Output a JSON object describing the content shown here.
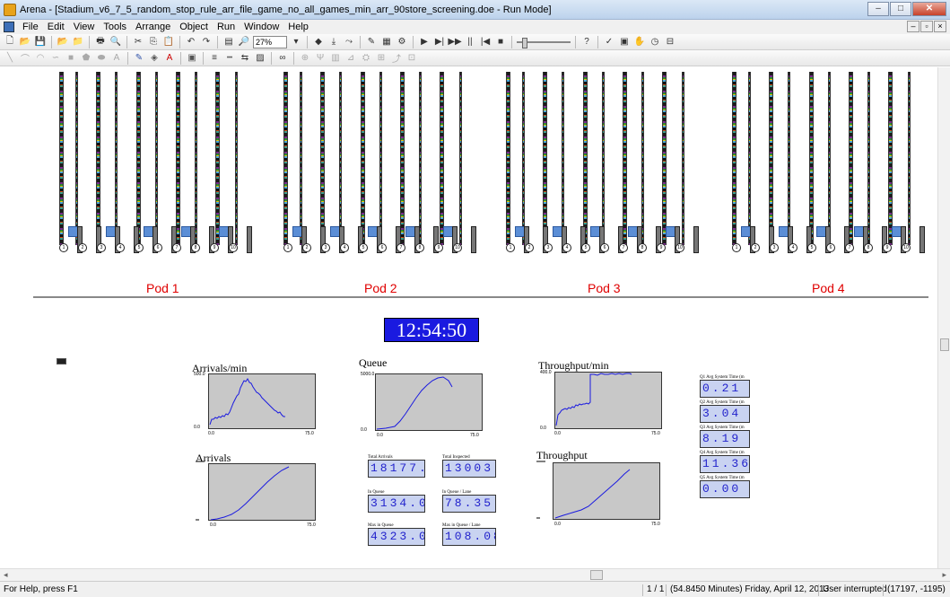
{
  "window": {
    "title": "Arena - [Stadium_v6_7_5_random_stop_rule_arr_file_game_no_all_games_min_arr_90store_screening.doe - Run Mode]",
    "minimize": "–",
    "maximize": "□",
    "close": "✕"
  },
  "menu": {
    "items": [
      "File",
      "Edit",
      "View",
      "Tools",
      "Arrange",
      "Object",
      "Run",
      "Window",
      "Help"
    ]
  },
  "toolbar": {
    "zoom": "27%"
  },
  "pods": [
    {
      "label": "Pod 1",
      "servers": [
        "1",
        "2",
        "3",
        "4",
        "5",
        "6",
        "7",
        "8",
        "9",
        "10"
      ]
    },
    {
      "label": "Pod 2",
      "servers": [
        "1",
        "2",
        "3",
        "4",
        "5",
        "6",
        "7",
        "8",
        "9",
        "10"
      ]
    },
    {
      "label": "Pod 3",
      "servers": [
        "1",
        "2",
        "3",
        "4",
        "5",
        "6",
        "7",
        "8",
        "9",
        "10"
      ]
    },
    {
      "label": "Pod 4",
      "servers": [
        "1",
        "2",
        "3",
        "4",
        "5",
        "6",
        "7",
        "8",
        "9",
        "10"
      ]
    }
  ],
  "clock": "12:54:50",
  "plots": {
    "arrivals_min": {
      "title": "Arrivals/min",
      "ymax": "500.0",
      "ymin": "0.0",
      "xmin": "0.0",
      "xmax": "75.0"
    },
    "queue": {
      "title": "Queue",
      "ymax": "5000.0",
      "ymin": "0.0",
      "xmin": "0.0",
      "xmax": "75.0"
    },
    "throughput_min": {
      "title": "Throughput/min",
      "ymax": "400.0",
      "ymin": "0.0",
      "xmin": "0.0",
      "xmax": "75.0"
    },
    "arrivals": {
      "title": "Arrivals",
      "xmin": "0.0",
      "xmax": "75.0"
    },
    "throughput": {
      "title": "Throughput",
      "xmin": "0.0",
      "xmax": "75.0"
    }
  },
  "monitors": {
    "total_arrivals": {
      "label": "Total Arrivals",
      "value": "18177.00"
    },
    "total_inspected": {
      "label": "Total Inspected",
      "value": "13003.00"
    },
    "in_queue": {
      "label": "In Queue",
      "value": "3134.00"
    },
    "in_queue_lane": {
      "label": "In Queue / Lane",
      "value": "78.35"
    },
    "max_in_queue": {
      "label": "Max in Queue",
      "value": "4323.00"
    },
    "max_in_queue_lane": {
      "label": "Max in Queue / Lane",
      "value": "108.08"
    }
  },
  "quantiles": [
    {
      "label": "Q1 Avg System Time (m",
      "value": "0.21"
    },
    {
      "label": "Q2 Avg System Time (m",
      "value": "3.04"
    },
    {
      "label": "Q3 Avg System Time (m",
      "value": "8.19"
    },
    {
      "label": "Q4 Avg System Time (m",
      "value": "11.36"
    },
    {
      "label": "Q5 Avg System Time (m",
      "value": "0.00"
    }
  ],
  "status": {
    "help": "For Help, press F1",
    "page": "1 / 1",
    "time": "(54.8450 Minutes) Friday, April 12, 2013",
    "state": "User interrupted",
    "coords": "(17197, -1195)"
  }
}
